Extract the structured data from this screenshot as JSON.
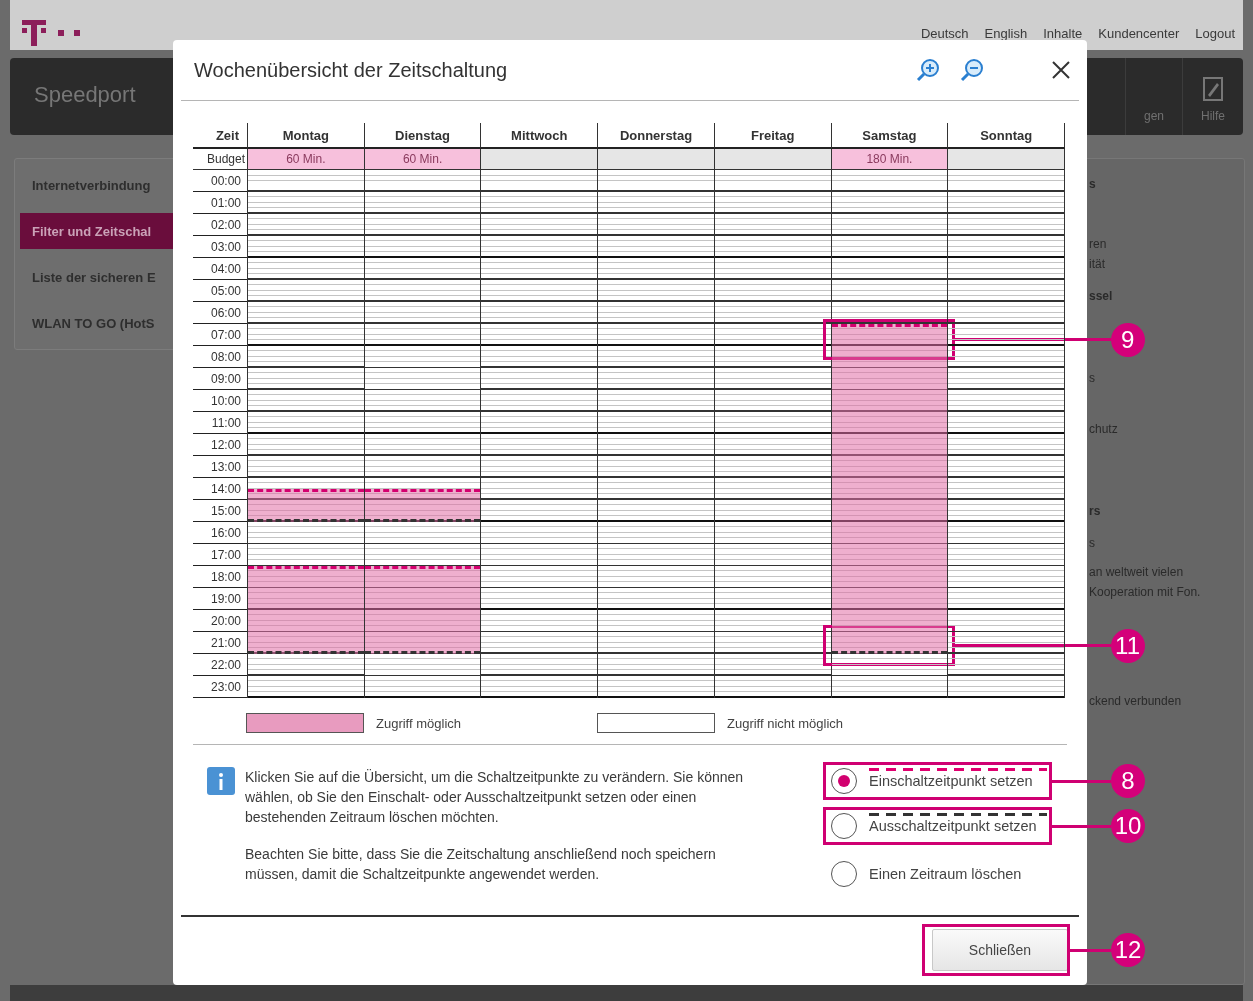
{
  "header": {
    "links": [
      "Deutsch",
      "English",
      "Inhalte",
      "Kundencenter",
      "Logout"
    ]
  },
  "nav": {
    "brand": "Speedport",
    "tabs": [
      {
        "label": "gen",
        "kind": "plain"
      },
      {
        "label": "Hilfe",
        "kind": "help"
      }
    ]
  },
  "sidebar": {
    "items": [
      {
        "label": "Internetverbindung",
        "selected": false
      },
      {
        "label": "Filter und Zeitschal",
        "selected": true
      },
      {
        "label": "Liste der sicheren E",
        "selected": false
      },
      {
        "label": "WLAN TO GO (HotS",
        "selected": false
      }
    ]
  },
  "side_panel": {
    "texts": [
      {
        "text": "s",
        "kind": "heading"
      },
      {
        "text": "ren",
        "kind": "plain"
      },
      {
        "text": "ität",
        "kind": "plain"
      },
      {
        "text": "ssel",
        "kind": "heading"
      },
      {
        "text": "s",
        "kind": "plain"
      },
      {
        "text": "chutz",
        "kind": "plain"
      },
      {
        "text": "rs",
        "kind": "heading"
      },
      {
        "text": "s",
        "kind": "plain"
      },
      {
        "text": "an weltweit vielen",
        "kind": "plain"
      },
      {
        "text": "Kooperation mit Fon.",
        "kind": "plain"
      },
      {
        "text": "ckend verbunden",
        "kind": "plain"
      }
    ]
  },
  "dialog": {
    "title": "Wochenübersicht der Zeitschaltung",
    "schedule": {
      "time_heading": "Zeit",
      "budget_label": "Budget",
      "days": [
        {
          "name": "Montag",
          "budget": "60 Min."
        },
        {
          "name": "Dienstag",
          "budget": "60 Min."
        },
        {
          "name": "Mittwoch"
        },
        {
          "name": "Donnerstag"
        },
        {
          "name": "Freitag"
        },
        {
          "name": "Samstag",
          "budget": "180 Min.",
          "start_callout": "9",
          "end_callout": "11"
        },
        {
          "name": "Sonntag"
        }
      ],
      "rows": [
        {
          "time": "00:00",
          "cells": [
            {
              "kind": "none"
            },
            {
              "kind": "none"
            },
            {
              "kind": "none"
            },
            {
              "kind": "none"
            },
            {
              "kind": "none"
            },
            {
              "kind": "none"
            },
            {
              "kind": "none"
            }
          ]
        },
        {
          "time": "01:00",
          "cells": [
            {
              "kind": "none"
            },
            {
              "kind": "none"
            },
            {
              "kind": "none"
            },
            {
              "kind": "none"
            },
            {
              "kind": "none"
            },
            {
              "kind": "none"
            },
            {
              "kind": "none"
            }
          ]
        },
        {
          "time": "02:00",
          "cells": [
            {
              "kind": "none"
            },
            {
              "kind": "none"
            },
            {
              "kind": "none"
            },
            {
              "kind": "none"
            },
            {
              "kind": "none"
            },
            {
              "kind": "none"
            },
            {
              "kind": "none"
            }
          ]
        },
        {
          "time": "03:00",
          "cells": [
            {
              "kind": "none"
            },
            {
              "kind": "none"
            },
            {
              "kind": "none"
            },
            {
              "kind": "none"
            },
            {
              "kind": "none"
            },
            {
              "kind": "none"
            },
            {
              "kind": "none"
            }
          ]
        },
        {
          "time": "04:00",
          "cells": [
            {
              "kind": "none"
            },
            {
              "kind": "none"
            },
            {
              "kind": "none"
            },
            {
              "kind": "none"
            },
            {
              "kind": "none"
            },
            {
              "kind": "none"
            },
            {
              "kind": "none"
            }
          ]
        },
        {
          "time": "05:00",
          "cells": [
            {
              "kind": "none"
            },
            {
              "kind": "none"
            },
            {
              "kind": "none"
            },
            {
              "kind": "none"
            },
            {
              "kind": "none"
            },
            {
              "kind": "none"
            },
            {
              "kind": "none"
            }
          ]
        },
        {
          "time": "06:00",
          "cells": [
            {
              "kind": "none"
            },
            {
              "kind": "none"
            },
            {
              "kind": "none"
            },
            {
              "kind": "none"
            },
            {
              "kind": "none"
            },
            {
              "kind": "none"
            },
            {
              "kind": "none"
            }
          ]
        },
        {
          "time": "07:00",
          "cells": [
            {
              "kind": "none"
            },
            {
              "kind": "none"
            },
            {
              "kind": "none"
            },
            {
              "kind": "none"
            },
            {
              "kind": "none"
            },
            {
              "kind": "full"
            },
            {
              "kind": "none"
            }
          ]
        },
        {
          "time": "08:00",
          "cells": [
            {
              "kind": "none"
            },
            {
              "kind": "none"
            },
            {
              "kind": "none"
            },
            {
              "kind": "none"
            },
            {
              "kind": "none"
            },
            {
              "kind": "full"
            },
            {
              "kind": "none"
            }
          ]
        },
        {
          "time": "09:00",
          "cells": [
            {
              "kind": "none"
            },
            {
              "kind": "none"
            },
            {
              "kind": "none"
            },
            {
              "kind": "none"
            },
            {
              "kind": "none"
            },
            {
              "kind": "full"
            },
            {
              "kind": "none"
            }
          ]
        },
        {
          "time": "10:00",
          "cells": [
            {
              "kind": "none"
            },
            {
              "kind": "none"
            },
            {
              "kind": "none"
            },
            {
              "kind": "none"
            },
            {
              "kind": "none"
            },
            {
              "kind": "full"
            },
            {
              "kind": "none"
            }
          ]
        },
        {
          "time": "11:00",
          "cells": [
            {
              "kind": "none"
            },
            {
              "kind": "none"
            },
            {
              "kind": "none"
            },
            {
              "kind": "none"
            },
            {
              "kind": "none"
            },
            {
              "kind": "full"
            },
            {
              "kind": "none"
            }
          ]
        },
        {
          "time": "12:00",
          "cells": [
            {
              "kind": "none"
            },
            {
              "kind": "none"
            },
            {
              "kind": "none"
            },
            {
              "kind": "none"
            },
            {
              "kind": "none"
            },
            {
              "kind": "full"
            },
            {
              "kind": "none"
            }
          ]
        },
        {
          "time": "13:00",
          "cells": [
            {
              "kind": "none"
            },
            {
              "kind": "none"
            },
            {
              "kind": "none"
            },
            {
              "kind": "none"
            },
            {
              "kind": "none"
            },
            {
              "kind": "full"
            },
            {
              "kind": "none"
            }
          ]
        },
        {
          "time": "14:00",
          "cells": [
            {
              "kind": "second_half"
            },
            {
              "kind": "second_half"
            },
            {
              "kind": "none"
            },
            {
              "kind": "none"
            },
            {
              "kind": "none"
            },
            {
              "kind": "full"
            },
            {
              "kind": "none"
            }
          ]
        },
        {
          "time": "15:00",
          "cells": [
            {
              "kind": "full"
            },
            {
              "kind": "full"
            },
            {
              "kind": "none"
            },
            {
              "kind": "none"
            },
            {
              "kind": "none"
            },
            {
              "kind": "full"
            },
            {
              "kind": "none"
            }
          ]
        },
        {
          "time": "16:00",
          "cells": [
            {
              "kind": "none"
            },
            {
              "kind": "none"
            },
            {
              "kind": "none"
            },
            {
              "kind": "none"
            },
            {
              "kind": "none"
            },
            {
              "kind": "full"
            },
            {
              "kind": "none"
            }
          ]
        },
        {
          "time": "17:00",
          "cells": [
            {
              "kind": "none"
            },
            {
              "kind": "none"
            },
            {
              "kind": "none"
            },
            {
              "kind": "none"
            },
            {
              "kind": "none"
            },
            {
              "kind": "full"
            },
            {
              "kind": "none"
            }
          ]
        },
        {
          "time": "18:00",
          "cells": [
            {
              "kind": "full"
            },
            {
              "kind": "full"
            },
            {
              "kind": "none"
            },
            {
              "kind": "none"
            },
            {
              "kind": "none"
            },
            {
              "kind": "full"
            },
            {
              "kind": "none"
            }
          ]
        },
        {
          "time": "19:00",
          "cells": [
            {
              "kind": "full"
            },
            {
              "kind": "full"
            },
            {
              "kind": "none"
            },
            {
              "kind": "none"
            },
            {
              "kind": "none"
            },
            {
              "kind": "full"
            },
            {
              "kind": "none"
            }
          ]
        },
        {
          "time": "20:00",
          "cells": [
            {
              "kind": "full"
            },
            {
              "kind": "full"
            },
            {
              "kind": "none"
            },
            {
              "kind": "none"
            },
            {
              "kind": "none"
            },
            {
              "kind": "full"
            },
            {
              "kind": "none"
            }
          ]
        },
        {
          "time": "21:00",
          "cells": [
            {
              "kind": "full"
            },
            {
              "kind": "full"
            },
            {
              "kind": "none"
            },
            {
              "kind": "none"
            },
            {
              "kind": "none"
            },
            {
              "kind": "full"
            },
            {
              "kind": "none"
            }
          ]
        },
        {
          "time": "22:00",
          "cells": [
            {
              "kind": "none"
            },
            {
              "kind": "none"
            },
            {
              "kind": "none"
            },
            {
              "kind": "none"
            },
            {
              "kind": "none"
            },
            {
              "kind": "none"
            },
            {
              "kind": "none"
            }
          ]
        },
        {
          "time": "23:00",
          "cells": [
            {
              "kind": "none"
            },
            {
              "kind": "none"
            },
            {
              "kind": "none"
            },
            {
              "kind": "none"
            },
            {
              "kind": "none"
            },
            {
              "kind": "none"
            },
            {
              "kind": "none"
            }
          ]
        }
      ]
    },
    "legend": [
      {
        "label": "Zugriff möglich",
        "access": true
      },
      {
        "label": "Zugriff nicht möglich",
        "access": false
      }
    ],
    "info": [
      "Klicken Sie auf die Übersicht, um die Schaltzeitpunkte zu verändern. Sie können wählen, ob Sie den Einschalt- oder Ausschaltzeitpunkt setzen oder einen bestehenden Zeitraum löschen möchten.",
      "Beachten Sie bitte, dass Sie die Zeitschaltung anschließend noch speichern müssen, damit die Schaltzeitpunkte angewendet werden."
    ],
    "options": [
      {
        "label": "Einschaltzeitpunkt setzen",
        "selected": true,
        "kind": "start",
        "callout": "8"
      },
      {
        "label": "Ausschaltzeitpunkt setzen",
        "selected": false,
        "kind": "end",
        "callout": "10"
      },
      {
        "label": "Einen Zeitraum löschen",
        "selected": false,
        "kind": "delete"
      }
    ],
    "close_button": {
      "label": "Schließen",
      "callout": "12"
    }
  }
}
